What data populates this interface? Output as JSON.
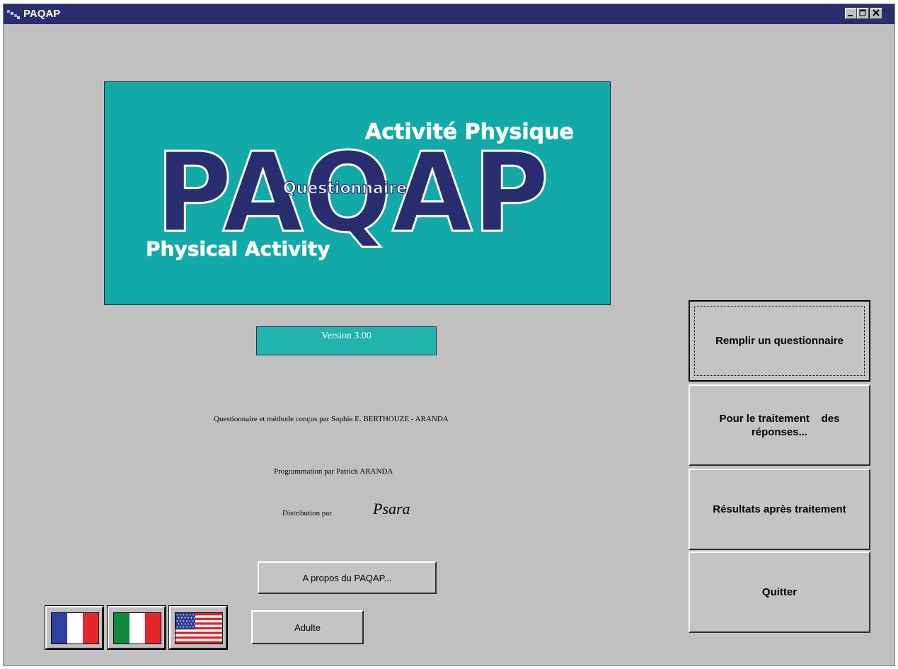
{
  "window": {
    "title": "PAQAP"
  },
  "titlebar_buttons": [
    {
      "name": "minimize",
      "icon": "minimize-icon"
    },
    {
      "name": "maximize",
      "icon": "maximize-icon"
    },
    {
      "name": "close",
      "icon": "close-icon"
    }
  ],
  "banner": {
    "logo_text": "PAQAP",
    "questionnaire": "Questionnaire",
    "fr_subtitle": "Activité Physique",
    "en_subtitle": "Physical Activity",
    "bg_color": "#12aaa9",
    "logo_color": "#292d6f"
  },
  "version": "Version 3.00",
  "credits": {
    "method": "Questionnaire et méthode conçus par Sophie E. BERTHOUZE - ARANDA",
    "programming": "Programmation par Patrick ARANDA",
    "distribution_label": "Distribution par",
    "distributor": "Psara"
  },
  "buttons": {
    "about": "A propos du PAQAP...",
    "age_group": "Adulte",
    "fill": "Remplir un questionnaire",
    "processing": "Pour le traitement    des réponses...",
    "results": "Résultats après traitement",
    "quit": "Quitter"
  },
  "flags": [
    {
      "name": "french-flag",
      "lang": "fr"
    },
    {
      "name": "italian-flag",
      "lang": "it"
    },
    {
      "name": "us-flag",
      "lang": "en"
    }
  ]
}
